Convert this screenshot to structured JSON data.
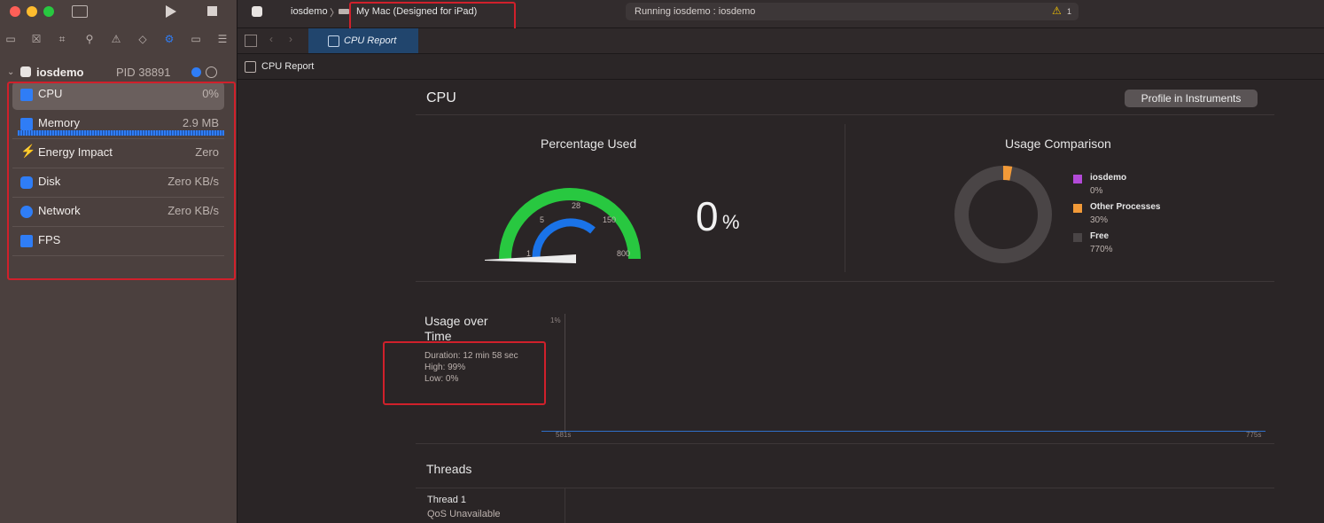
{
  "sidebar": {
    "process": {
      "name": "iosdemo",
      "pid_label": "PID 38891"
    },
    "items": [
      {
        "label": "CPU",
        "value": "0%"
      },
      {
        "label": "Memory",
        "value": "2.9 MB"
      },
      {
        "label": "Energy Impact",
        "value": "Zero"
      },
      {
        "label": "Disk",
        "value": "Zero KB/s"
      },
      {
        "label": "Network",
        "value": "Zero KB/s"
      },
      {
        "label": "FPS",
        "value": ""
      }
    ]
  },
  "toolbar": {
    "scheme": "iosdemo",
    "destination": "My Mac (Designed for iPad)",
    "status": "Running iosdemo : iosdemo",
    "warning_count": "1"
  },
  "tabs": [
    {
      "label": "CPU Report"
    }
  ],
  "jumpbar": {
    "label": "CPU Report"
  },
  "report": {
    "title": "CPU",
    "profile_button": "Profile in Instruments",
    "percentage": {
      "title": "Percentage Used",
      "value": "0",
      "unit": "%",
      "gauge_labels": [
        "1",
        "5",
        "28",
        "150",
        "800"
      ]
    },
    "comparison": {
      "title": "Usage Comparison",
      "legend": [
        {
          "name": "iosdemo",
          "value": "0%",
          "color": "#b34ad8"
        },
        {
          "name": "Other Processes",
          "value": "30%",
          "color": "#f29a38"
        },
        {
          "name": "Free",
          "value": "770%",
          "color": "#4a4546"
        }
      ]
    },
    "usage_over_time": {
      "title_line1": "Usage over",
      "title_line2": "Time",
      "duration": "Duration: 12 min 58 sec",
      "high": "High: 99%",
      "low": "Low: 0%",
      "y_label": "1%",
      "x_start": "581s",
      "x_end": "775s"
    },
    "threads": {
      "title": "Threads",
      "thread_name": "Thread 1",
      "thread_qos": "QoS Unavailable"
    }
  },
  "colors": {
    "accent": "#1a73e8",
    "gauge_green": "#28c840",
    "gauge_blue": "#1a73e8",
    "highlight_red": "#d0202b"
  }
}
